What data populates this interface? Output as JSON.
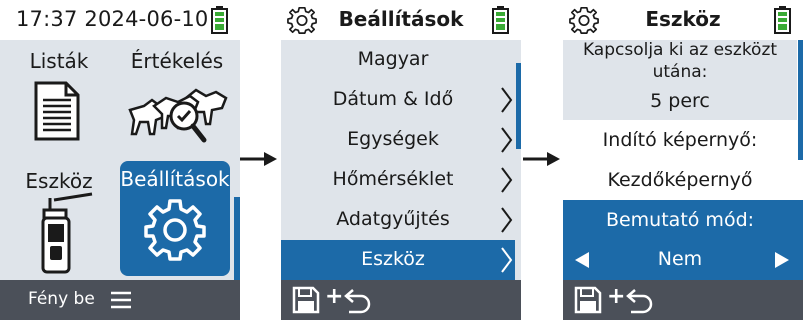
{
  "colors": {
    "accent": "#1c6aa8",
    "panel": "#dfe4ea",
    "bar": "#4b5059",
    "battery": "#3aaa35"
  },
  "screen1": {
    "time": "17:37",
    "date": "2024-06-10",
    "tiles": [
      {
        "label": "Listák",
        "icon": "document-list-icon"
      },
      {
        "label": "Értékelés",
        "icon": "cattle-magnifier-icon"
      },
      {
        "label": "Eszköz",
        "icon": "handheld-device-icon"
      },
      {
        "label": "Beállítások",
        "icon": "gear-icon",
        "selected": true
      }
    ],
    "footer": "Fény be"
  },
  "screen2": {
    "title": "Beállítások",
    "items": [
      {
        "label": "Magyar",
        "has_chevron": false
      },
      {
        "label": "Dátum & Idő",
        "has_chevron": true
      },
      {
        "label": "Egységek",
        "has_chevron": true
      },
      {
        "label": "Hőmérséklet",
        "has_chevron": true
      },
      {
        "label": "Adatgyűjtés",
        "has_chevron": true
      },
      {
        "label": "Eszköz",
        "has_chevron": true,
        "selected": true
      }
    ]
  },
  "screen3": {
    "title": "Eszköz",
    "auto_off_line1": "Kapcsolja ki az eszközt",
    "auto_off_line2": "utána:",
    "auto_off_value": "5 perc",
    "start_screen_label": "Indító képernyő:",
    "start_screen_value": "Kezdőképernyő",
    "demo_label": "Bemutató mód:",
    "demo_value": "Nem"
  },
  "footer_actions": {
    "plus": "+"
  }
}
